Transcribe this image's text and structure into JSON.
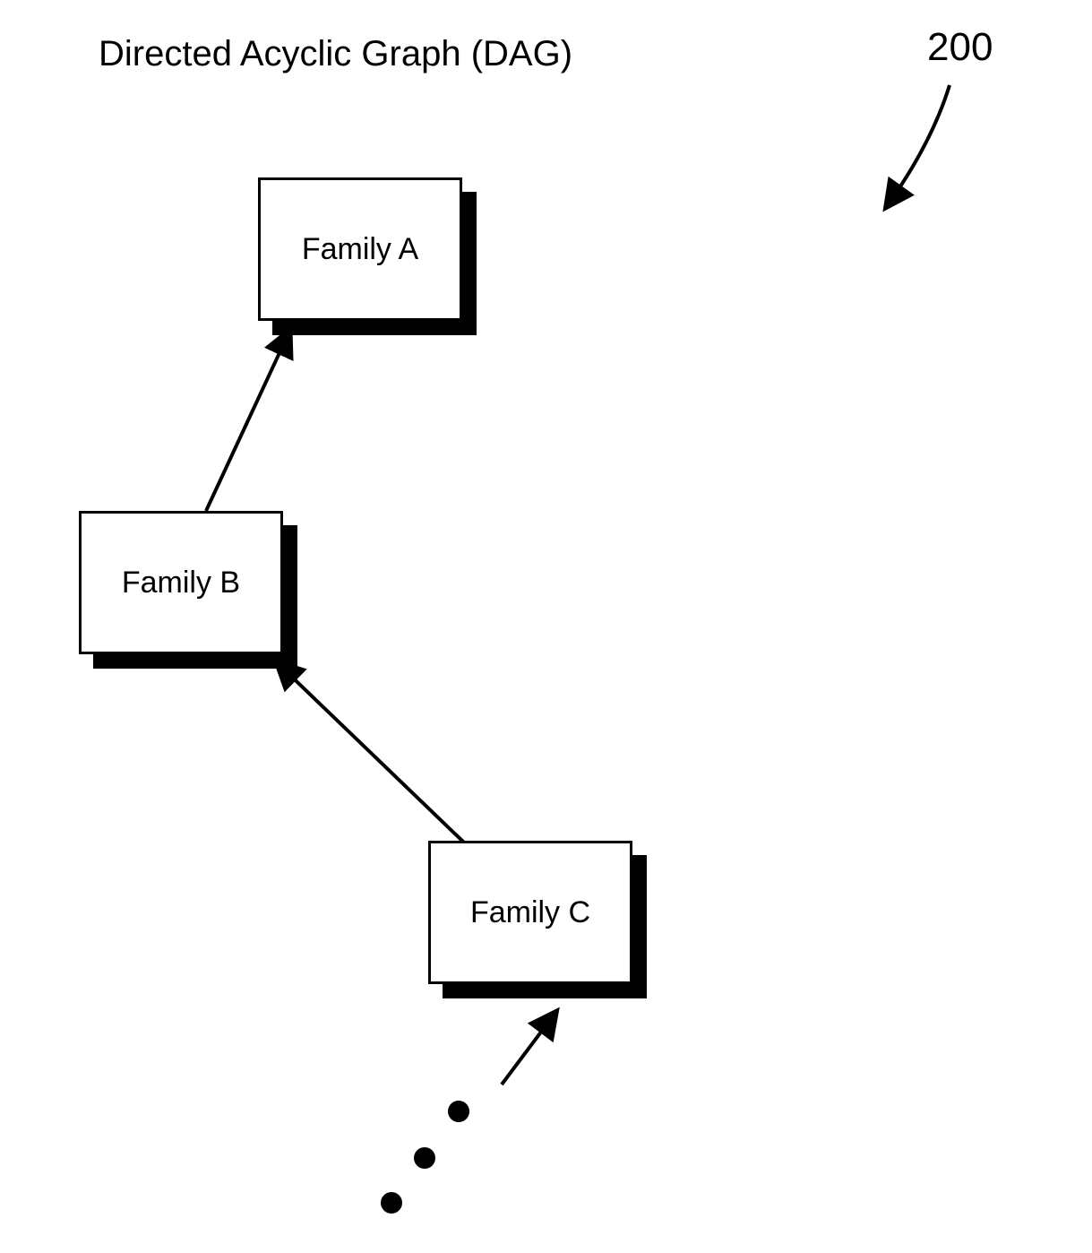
{
  "diagram": {
    "title": "Directed Acyclic Graph (DAG)",
    "reference_number": "200",
    "nodes": {
      "a": {
        "label": "Family A"
      },
      "b": {
        "label": "Family B"
      },
      "c": {
        "label": "Family C"
      }
    }
  }
}
